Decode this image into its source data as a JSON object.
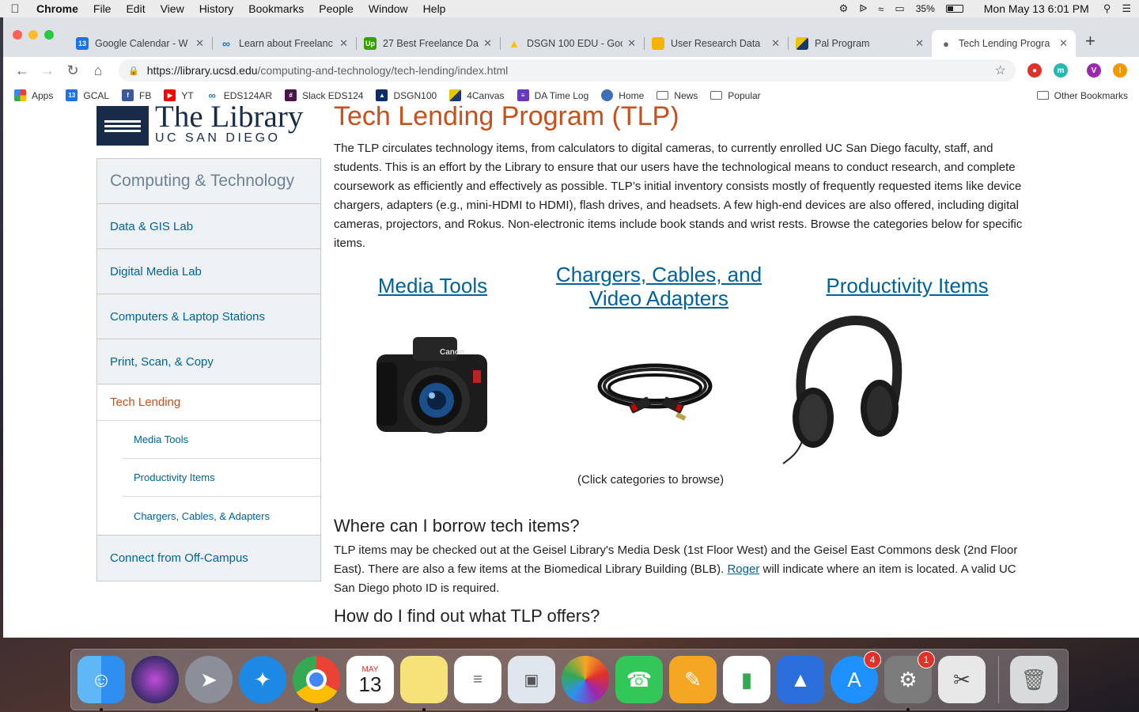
{
  "menubar": {
    "app": "Chrome",
    "menus": [
      "File",
      "Edit",
      "View",
      "History",
      "Bookmarks",
      "People",
      "Window",
      "Help"
    ],
    "battery": "35%",
    "clock": "Mon May 13  6:01 PM"
  },
  "tabs": [
    {
      "title": "Google Calendar - W",
      "icon": "calendar-icon",
      "color": "#1a73e8"
    },
    {
      "title": "Learn about Freelanc",
      "icon": "infinity-icon",
      "color": "#1a73e8"
    },
    {
      "title": "27 Best Freelance Da",
      "icon": "upwork-icon",
      "color": "#37a000"
    },
    {
      "title": "DSGN 100 EDU - Goo",
      "icon": "drive-icon",
      "color": "#fbbc04"
    },
    {
      "title": "User Research Data",
      "icon": "slides-icon",
      "color": "#f4b400"
    },
    {
      "title": "Pal Program",
      "icon": "canvas-icon",
      "color": "#c9a800"
    },
    {
      "title": "Tech Lending Progra",
      "icon": "globe-icon",
      "color": "#5f6368"
    }
  ],
  "address": {
    "host": "https://library.ucsd.edu",
    "path": "/computing-and-technology/tech-lending/index.html"
  },
  "bookmarks": [
    {
      "label": "Apps",
      "color": "#e94235"
    },
    {
      "label": "GCAL",
      "color": "#1a73e8"
    },
    {
      "label": "FB",
      "color": "#3b5998"
    },
    {
      "label": "YT",
      "color": "#ff0000"
    },
    {
      "label": "EDS124AR",
      "color": "#1a73e8"
    },
    {
      "label": "Slack EDS124",
      "color": "#4a154b"
    },
    {
      "label": "DSGN100",
      "color": "#0b2e6b"
    },
    {
      "label": "4Canvas",
      "color": "#c9a800"
    },
    {
      "label": "DA Time Log",
      "color": "#673ab7"
    },
    {
      "label": "Home",
      "color": "#3f6fb5"
    },
    {
      "label": "News",
      "color": ""
    },
    {
      "label": "Popular",
      "color": ""
    }
  ],
  "other_bookmarks": "Other Bookmarks",
  "extension_avatar": "V",
  "logo": {
    "line1": "The Library",
    "line2": "UC SAN DIEGO"
  },
  "sidenav": {
    "heading": "Computing & Technology",
    "items": [
      "Data & GIS Lab",
      "Digital Media Lab",
      "Computers & Laptop Stations",
      "Print, Scan, & Copy"
    ],
    "active": "Tech Lending",
    "subitems": [
      "Media Tools",
      "Productivity Items",
      "Chargers, Cables, & Adapters"
    ],
    "last": "Connect from Off-Campus"
  },
  "content": {
    "title": "Tech Lending Program (TLP)",
    "intro": "The TLP circulates technology items, from calculators to digital cameras, to currently enrolled UC San Diego faculty, staff, and students. This is an effort by the Library to ensure that our users have the technological means to conduct research, and complete coursework as efficiently and effectively as possible. TLP’s initial inventory consists mostly of frequently requested items like device chargers, adapters (e.g., mini-HDMI to HDMI), flash drives, and headsets. A few high-end devices are also offered, including digital cameras, projectors, and Rokus. Non-electronic items include book stands and wrist rests. Browse the categories below for specific items.",
    "categories": [
      "Media Tools",
      "Chargers, Cables, and Video Adapters",
      "Productivity Items"
    ],
    "camera_brand": "Canon",
    "categories_note": "(Click categories to browse)",
    "where_heading": "Where can I borrow tech items?",
    "where_text_1": "TLP items may be checked out at the Geisel Library's Media Desk (1st Floor West) and the Geisel East Commons desk (2nd Floor East).  There are also a few items at the Biomedical Library Building (BLB).",
    "where_link": "Roger",
    "where_text_2": " will indicate where an item is located. A valid UC San Diego photo ID is required.",
    "find_heading": "How do I find out what TLP offers?"
  },
  "dock": {
    "apps": [
      {
        "name": "finder-icon",
        "color": "#2f8ff0"
      },
      {
        "name": "siri-icon",
        "color": "#3a2d6b"
      },
      {
        "name": "launchpad-icon",
        "color": "#8a8f99"
      },
      {
        "name": "safari-icon",
        "color": "#1e88e5"
      },
      {
        "name": "chrome-icon",
        "color": "#ffffff"
      },
      {
        "name": "calendar-icon",
        "color": "#ffffff"
      },
      {
        "name": "notes-icon",
        "color": "#f7e27a"
      },
      {
        "name": "reminders-icon",
        "color": "#ffffff"
      },
      {
        "name": "preview-icon",
        "color": "#dfe6ee"
      },
      {
        "name": "photos-icon",
        "color": "#ffffff"
      },
      {
        "name": "facetime-icon",
        "color": "#33c659"
      },
      {
        "name": "pages-icon",
        "color": "#f5a623"
      },
      {
        "name": "numbers-icon",
        "color": "#ffffff"
      },
      {
        "name": "keynote-icon",
        "color": "#2a6fdb"
      },
      {
        "name": "app-store-icon",
        "color": "#1e90ff"
      },
      {
        "name": "system-preferences-icon",
        "color": "#7b7b7b"
      },
      {
        "name": "screenshot-tool-icon",
        "color": "#e8e8e8"
      },
      {
        "name": "trash-icon",
        "color": "#d8dadc"
      }
    ],
    "calendar_month": "MAY",
    "calendar_day": "13",
    "app_store_badge": "4",
    "system_prefs_badge": "1"
  }
}
